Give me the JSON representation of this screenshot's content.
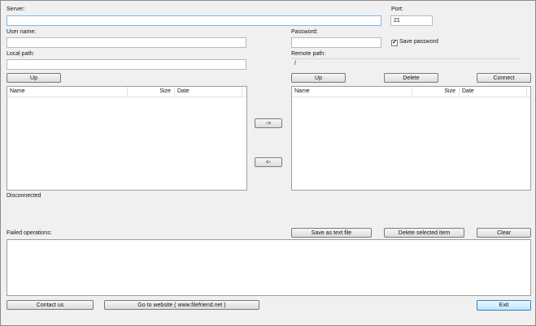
{
  "server": {
    "label": "Server:",
    "value": ""
  },
  "port": {
    "label": "Port:",
    "value": "21"
  },
  "username": {
    "label": "User name:",
    "value": ""
  },
  "password": {
    "label": "Password:",
    "value": ""
  },
  "save_password": {
    "label": "Save password",
    "checked": true,
    "check_glyph": "✔"
  },
  "local_path": {
    "label": "Local path:",
    "value": ""
  },
  "remote_path": {
    "label": "Remote path:",
    "value": "/"
  },
  "local_pane": {
    "up_label": "Up",
    "columns": [
      "Name",
      "Size",
      "Date"
    ]
  },
  "remote_pane": {
    "up_label": "Up",
    "delete_label": "Delete",
    "connect_label": "Connect",
    "columns": [
      "Name",
      "Size",
      "Date"
    ]
  },
  "transfer": {
    "upload_label": "->",
    "download_label": "<-"
  },
  "status": {
    "text": "Disconnected"
  },
  "failed_ops": {
    "label": "Failed operations:",
    "save_label": "Save as text file",
    "delete_selected_label": "Delete selected item",
    "clear_label": "Clear"
  },
  "footer": {
    "contact_label": "Contact us",
    "website_label": "Go to website ( www.filefriend.net )",
    "exit_label": "Exit"
  }
}
